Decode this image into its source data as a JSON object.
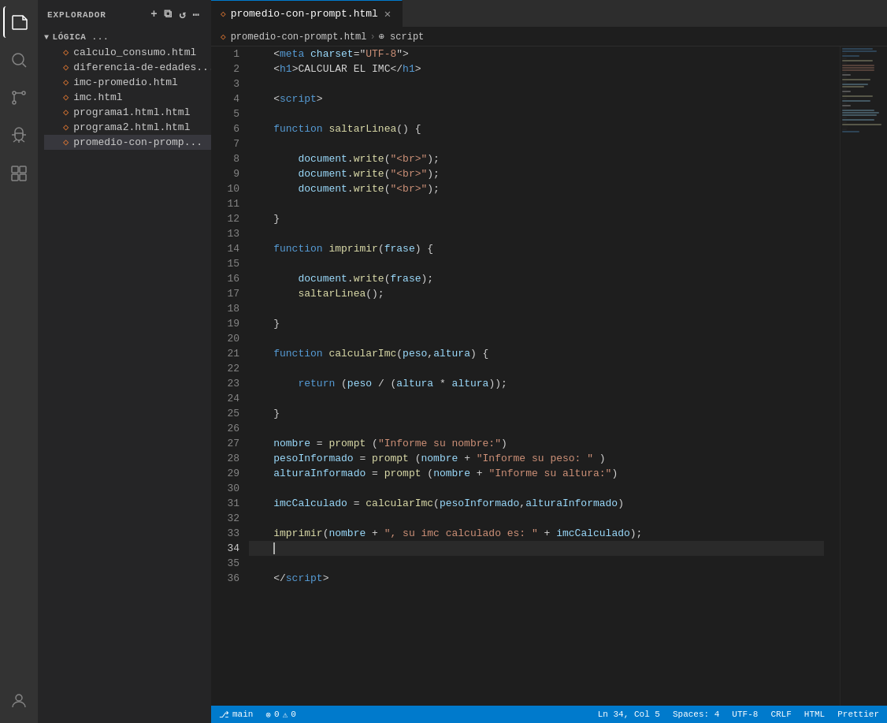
{
  "activityBar": {
    "icons": [
      {
        "name": "files-icon",
        "symbol": "⧉",
        "active": true
      },
      {
        "name": "search-icon",
        "symbol": "🔍",
        "active": false
      },
      {
        "name": "source-control-icon",
        "symbol": "⎇",
        "active": false
      },
      {
        "name": "debug-icon",
        "symbol": "▷",
        "active": false
      },
      {
        "name": "extensions-icon",
        "symbol": "⊞",
        "active": false
      }
    ],
    "bottomIcons": [
      {
        "name": "account-icon",
        "symbol": "👤"
      }
    ]
  },
  "sidebar": {
    "header": "EXPLORADOR",
    "sectionTitle": "LÓGICA ...",
    "icons": [
      "＋",
      "⧉",
      "↺",
      "⋯"
    ],
    "files": [
      {
        "name": "calculo_consumo.html",
        "active": false
      },
      {
        "name": "diferencia-de-edades...",
        "active": false
      },
      {
        "name": "imc-promedio.html",
        "active": false
      },
      {
        "name": "imc.html",
        "active": false
      },
      {
        "name": "programa1.html.html",
        "active": false
      },
      {
        "name": "programa2.html.html",
        "active": false
      },
      {
        "name": "promedio-con-promp...",
        "active": true
      }
    ]
  },
  "tabs": [
    {
      "label": "promedio-con-prompt.html",
      "active": true,
      "closeable": true
    }
  ],
  "breadcrumb": {
    "parts": [
      "promedio-con-prompt.html",
      "script"
    ]
  },
  "code": {
    "lines": [
      {
        "num": 1,
        "content": "meta"
      },
      {
        "num": 2,
        "content": "h1"
      },
      {
        "num": 3,
        "content": ""
      },
      {
        "num": 4,
        "content": "script_open"
      },
      {
        "num": 5,
        "content": ""
      },
      {
        "num": 6,
        "content": "fn_saltarLinea"
      },
      {
        "num": 7,
        "content": ""
      },
      {
        "num": 8,
        "content": "doc_write_br1"
      },
      {
        "num": 9,
        "content": "doc_write_br2"
      },
      {
        "num": 10,
        "content": "doc_write_br3"
      },
      {
        "num": 11,
        "content": ""
      },
      {
        "num": 12,
        "content": "close_brace"
      },
      {
        "num": 13,
        "content": ""
      },
      {
        "num": 14,
        "content": "fn_imprimir"
      },
      {
        "num": 15,
        "content": ""
      },
      {
        "num": 16,
        "content": "doc_write_frase"
      },
      {
        "num": 17,
        "content": "saltarLinea_call"
      },
      {
        "num": 18,
        "content": ""
      },
      {
        "num": 19,
        "content": "close_brace"
      },
      {
        "num": 20,
        "content": ""
      },
      {
        "num": 21,
        "content": "fn_calcularImc"
      },
      {
        "num": 22,
        "content": ""
      },
      {
        "num": 23,
        "content": "return_stmt"
      },
      {
        "num": 24,
        "content": ""
      },
      {
        "num": 25,
        "content": "close_brace"
      },
      {
        "num": 26,
        "content": ""
      },
      {
        "num": 27,
        "content": "nombre_prompt"
      },
      {
        "num": 28,
        "content": "peso_prompt"
      },
      {
        "num": 29,
        "content": "altura_prompt"
      },
      {
        "num": 30,
        "content": ""
      },
      {
        "num": 31,
        "content": "imc_calc"
      },
      {
        "num": 32,
        "content": ""
      },
      {
        "num": 33,
        "content": "imprimir_call"
      },
      {
        "num": 34,
        "content": "cursor_line"
      },
      {
        "num": 35,
        "content": ""
      },
      {
        "num": 36,
        "content": "script_close"
      }
    ]
  },
  "statusBar": {
    "left": [
      "main",
      "0 problems"
    ],
    "right": [
      "Ln 34, Col 5",
      "Spaces: 4",
      "UTF-8",
      "CRLF",
      "HTML",
      "Prettier"
    ]
  }
}
